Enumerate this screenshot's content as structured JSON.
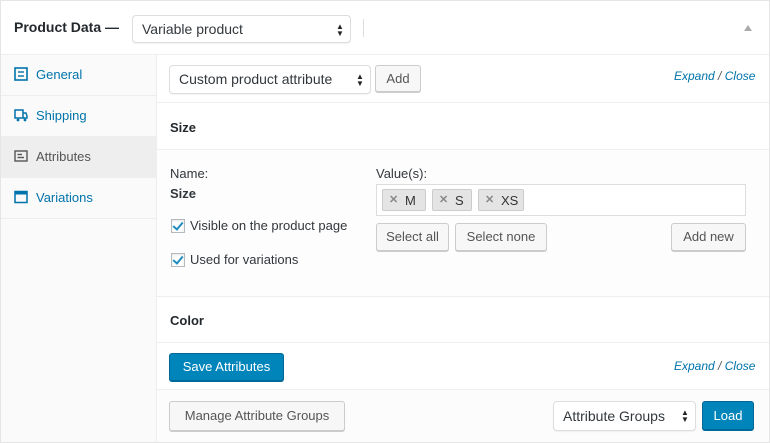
{
  "header": {
    "title": "Product Data —",
    "type_select": "Variable product"
  },
  "sidebar": {
    "tabs": [
      {
        "label": "General",
        "icon": "wrench-icon"
      },
      {
        "label": "Shipping",
        "icon": "truck-icon"
      },
      {
        "label": "Attributes",
        "icon": "list-icon"
      },
      {
        "label": "Variations",
        "icon": "grid-icon"
      }
    ],
    "active": "Attributes"
  },
  "toolbar": {
    "attribute_select": "Custom product attribute",
    "add_button": "Add",
    "expand": "Expand",
    "slash": "/",
    "close": "Close"
  },
  "attributes": [
    {
      "title": "Size",
      "name_label": "Name:",
      "name_value": "Size",
      "values_label": "Value(s):",
      "values": [
        "M",
        "S",
        "XS"
      ],
      "visible_label": "Visible on the product page",
      "variations_label": "Used for variations",
      "select_all": "Select all",
      "select_none": "Select none",
      "add_new": "Add new"
    },
    {
      "title": "Color"
    }
  ],
  "actions": {
    "save_button": "Save Attributes",
    "expand": "Expand",
    "slash": "/",
    "close": "Close"
  },
  "footer": {
    "manage_button": "Manage Attribute Groups",
    "groups_select": "Attribute Groups",
    "load_button": "Load"
  },
  "colors": {
    "accent": "#0085ba",
    "link": "#0073aa"
  }
}
